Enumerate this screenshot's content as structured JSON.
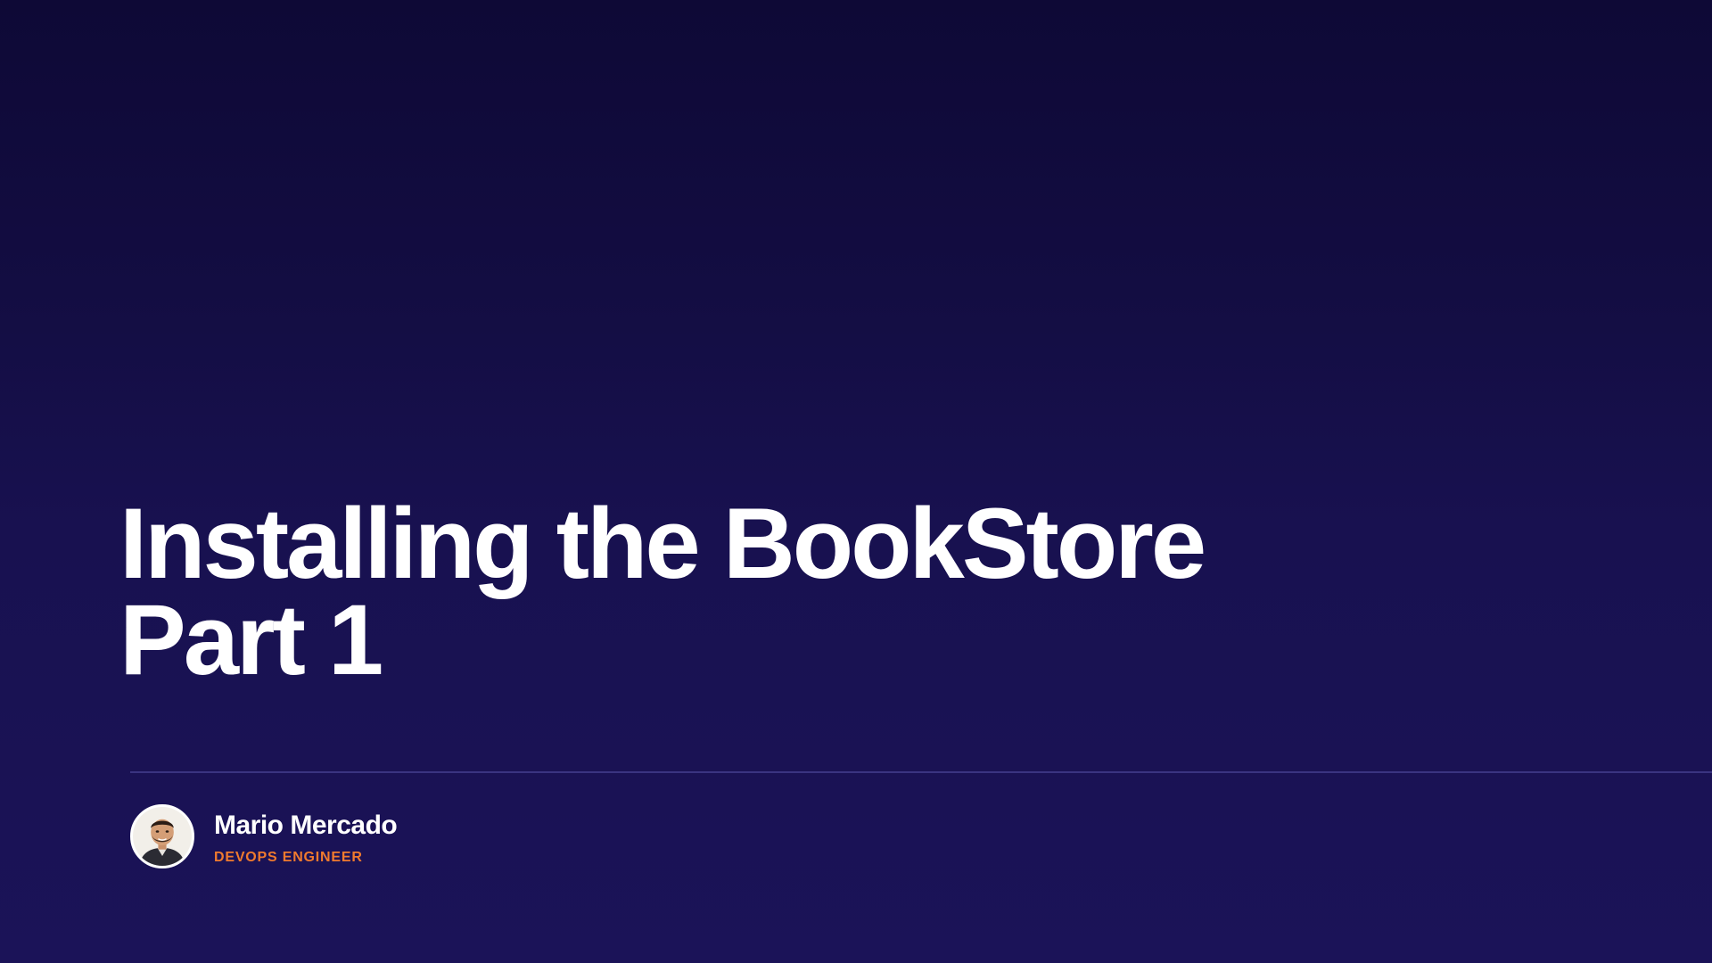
{
  "slide": {
    "title_lines": [
      "Installing the BookStore",
      "Part 1"
    ],
    "author": {
      "name": "Mario Mercado",
      "role": "DEVOPS ENGINEER",
      "avatar_icon": "person-avatar-icon"
    }
  },
  "colors": {
    "background_top": "#0e0936",
    "background_bottom": "#1b1358",
    "title": "#ffffff",
    "role_accent": "#f07a2e",
    "divider": "#3a3480"
  }
}
